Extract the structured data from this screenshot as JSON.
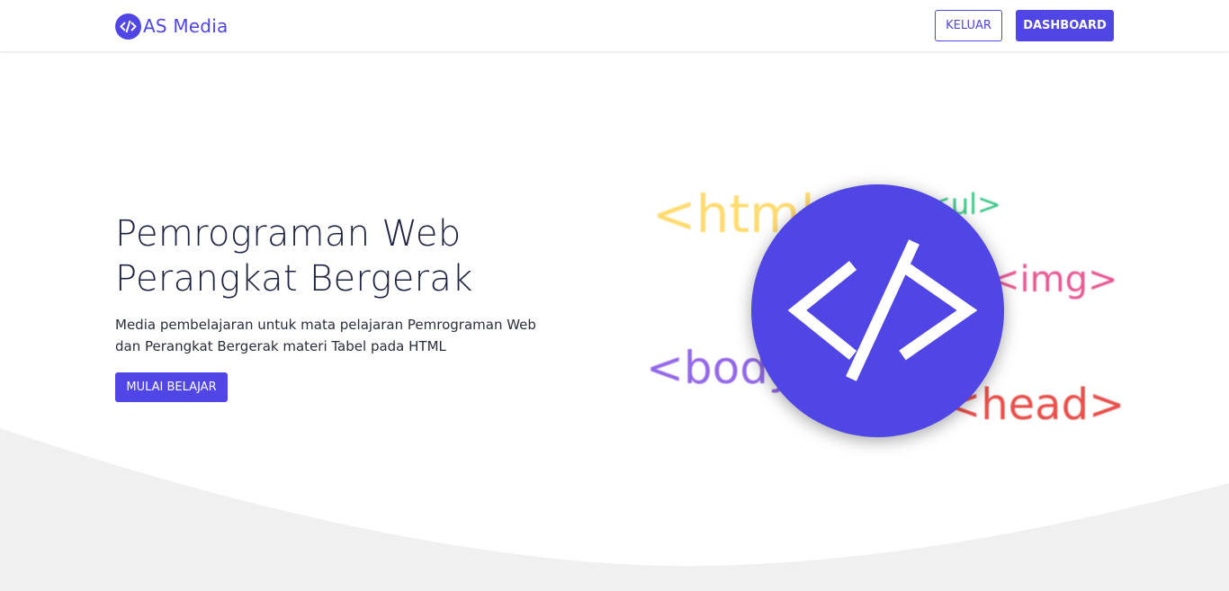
{
  "brand": {
    "name": "AS Media",
    "logo_icon": "code-slash-icon"
  },
  "nav": {
    "logout_label": "KELUAR",
    "dashboard_label": "DASHBOARD"
  },
  "hero": {
    "title_line1": "Pemrograman Web",
    "title_line2": "Perangkat Bergerak",
    "desc_line1": "Media pembelajaran untuk mata pelajaran Pemrograman Web",
    "desc_line2": "dan Perangkat Bergerak materi Tabel pada HTML",
    "start_label": "MULAI BELAJAR"
  },
  "illustration": {
    "center_icon": "code-slash-icon",
    "tags": [
      {
        "text": "<html>",
        "color": "#ffd966"
      },
      {
        "text": "<ul>",
        "color": "#2ec27e"
      },
      {
        "text": "<img>",
        "color": "#e84a8a"
      },
      {
        "text": "<body>",
        "color": "#8a5ce6"
      },
      {
        "text": "<head>",
        "color": "#e8413c"
      }
    ]
  },
  "colors": {
    "primary": "#4f46e5",
    "brand_text": "#4f46e5",
    "wave": "#f0f0f0",
    "title": "#1f2340"
  }
}
